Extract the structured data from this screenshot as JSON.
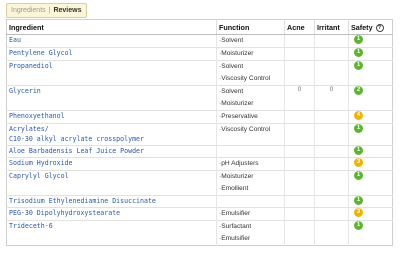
{
  "tabs": {
    "inactive": "Ingredients",
    "separator": "|",
    "active": "Reviews"
  },
  "headers": {
    "ingredient": "Ingredient",
    "function": "Function",
    "acne": "Acne",
    "irritant": "Irritant",
    "safety": "Safety"
  },
  "info_icon_glyph": "?",
  "colors": {
    "safe": "#5cb531",
    "moderate": "#f0b400",
    "link": "#2a58a8"
  },
  "rows": [
    {
      "name": [
        "Eau"
      ],
      "functions": [
        "Solvent"
      ],
      "acne": "",
      "irritant": "",
      "safety": "1"
    },
    {
      "name": [
        "Pentylene Glycol"
      ],
      "functions": [
        "Moisturizer"
      ],
      "acne": "",
      "irritant": "",
      "safety": "1"
    },
    {
      "name": [
        "Propanediol"
      ],
      "functions": [
        "Solvent",
        "Viscosity Control"
      ],
      "acne": "",
      "irritant": "",
      "safety": "1"
    },
    {
      "name": [
        "Glycerin"
      ],
      "functions": [
        "Solvent",
        "Moisturizer"
      ],
      "acne": "0",
      "irritant": "0",
      "safety": "2"
    },
    {
      "name": [
        "Phenoxyethanol"
      ],
      "functions": [
        "Preservative"
      ],
      "acne": "",
      "irritant": "",
      "safety": "4"
    },
    {
      "name": [
        "Acrylates/",
        "C10-30 alkyl acrylate crosspolymer"
      ],
      "functions": [
        "Viscosity Control"
      ],
      "acne": "",
      "irritant": "",
      "safety": "1"
    },
    {
      "name": [
        "Aloe Barbadensis Leaf Juice Powder"
      ],
      "functions": [],
      "acne": "",
      "irritant": "",
      "safety": "1"
    },
    {
      "name": [
        "Sodium Hydroxide"
      ],
      "functions": [
        "pH Adjusters"
      ],
      "acne": "",
      "irritant": "",
      "safety": "3"
    },
    {
      "name": [
        "Caprylyl Glycol"
      ],
      "functions": [
        "Moisturizer",
        "Emollient"
      ],
      "acne": "",
      "irritant": "",
      "safety": "1"
    },
    {
      "name": [
        "Trisodium Ethylenediamine Disuccinate"
      ],
      "functions": [],
      "acne": "",
      "irritant": "",
      "safety": "1"
    },
    {
      "name": [
        "PEG-30 Dipolyhydroxystearate"
      ],
      "functions": [
        "Emulsifier"
      ],
      "acne": "",
      "irritant": "",
      "safety": "3"
    },
    {
      "name": [
        "Trideceth-6"
      ],
      "functions": [
        "Surfactant",
        "Emulsifier"
      ],
      "acne": "",
      "irritant": "",
      "safety": "1"
    }
  ]
}
